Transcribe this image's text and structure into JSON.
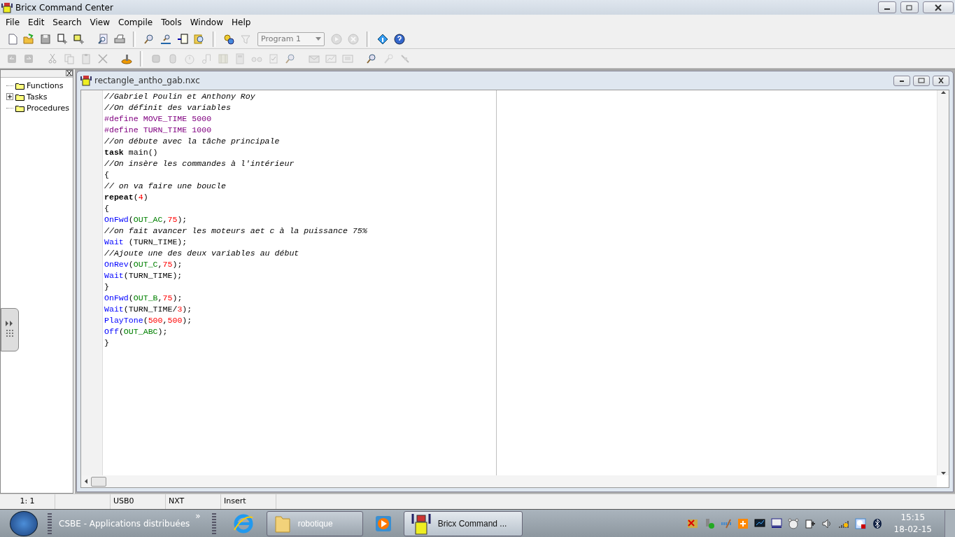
{
  "window": {
    "title": "Bricx Command Center"
  },
  "menu": [
    "File",
    "Edit",
    "Search",
    "View",
    "Compile",
    "Tools",
    "Window",
    "Help"
  ],
  "toolbar_1": [
    {
      "kind": "new",
      "disabled": false
    },
    {
      "kind": "open",
      "disabled": false
    },
    {
      "kind": "save",
      "disabled": false
    },
    {
      "kind": "download",
      "disabled": false
    },
    {
      "kind": "download-all",
      "disabled": false
    },
    {
      "kind": "sep"
    },
    {
      "kind": "preview",
      "disabled": false
    },
    {
      "kind": "print",
      "disabled": false
    },
    {
      "kind": "bar"
    },
    {
      "kind": "find",
      "disabled": false
    },
    {
      "kind": "replace",
      "disabled": false
    },
    {
      "kind": "goto",
      "disabled": false
    },
    {
      "kind": "find-file",
      "disabled": false
    },
    {
      "kind": "bar"
    },
    {
      "kind": "compile",
      "disabled": false
    },
    {
      "kind": "filter",
      "disabled": true
    },
    {
      "kind": "program",
      "value": "Program 1",
      "disabled": true
    },
    {
      "kind": "run",
      "disabled": true
    },
    {
      "kind": "stop",
      "disabled": true
    },
    {
      "kind": "bar"
    },
    {
      "kind": "info",
      "disabled": false
    },
    {
      "kind": "help",
      "disabled": false
    }
  ],
  "toolbar_2": [
    {
      "kind": "undo",
      "disabled": true
    },
    {
      "kind": "redo",
      "disabled": true
    },
    {
      "kind": "sep"
    },
    {
      "kind": "cut",
      "disabled": true
    },
    {
      "kind": "copy",
      "disabled": true
    },
    {
      "kind": "paste",
      "disabled": true
    },
    {
      "kind": "delete",
      "disabled": true
    },
    {
      "kind": "sep"
    },
    {
      "kind": "joystick",
      "disabled": false
    },
    {
      "kind": "bar"
    },
    {
      "kind": "robot",
      "disabled": true
    },
    {
      "kind": "bottle",
      "disabled": true
    },
    {
      "kind": "stopwatch",
      "disabled": true
    },
    {
      "kind": "note",
      "disabled": true
    },
    {
      "kind": "film",
      "disabled": true
    },
    {
      "kind": "calculator",
      "disabled": true
    },
    {
      "kind": "glasses",
      "disabled": true
    },
    {
      "kind": "checklist",
      "disabled": true
    },
    {
      "kind": "find",
      "disabled": true
    },
    {
      "kind": "sep"
    },
    {
      "kind": "mail",
      "disabled": true
    },
    {
      "kind": "chart",
      "disabled": true
    },
    {
      "kind": "screen",
      "disabled": true
    },
    {
      "kind": "sep"
    },
    {
      "kind": "find",
      "disabled": false
    },
    {
      "kind": "key",
      "disabled": true
    },
    {
      "kind": "plug",
      "disabled": true
    }
  ],
  "code_explorer": {
    "items": [
      {
        "label": "Functions"
      },
      {
        "label": "Tasks",
        "expanded": false
      },
      {
        "label": "Procedures"
      }
    ]
  },
  "editor": {
    "title": "rectangle_antho_gab.nxc",
    "lines": [
      [
        {
          "kind": "comment",
          "text": "//Gabriel Poulin et Anthony Roy"
        }
      ],
      [
        {
          "kind": "comment",
          "text": "//On définit des variables"
        }
      ],
      [
        {
          "kind": "preproc",
          "text": "#define "
        },
        {
          "kind": "macro",
          "text": "MOVE_TIME"
        },
        {
          "kind": "macro",
          "text": " 5000"
        }
      ],
      [
        {
          "kind": "preproc",
          "text": "#define "
        },
        {
          "kind": "macro",
          "text": "TURN_TIME"
        },
        {
          "kind": "macro",
          "text": " 1000"
        }
      ],
      [
        {
          "kind": "comment",
          "text": "//on débute avec la tâche principale"
        }
      ],
      [
        {
          "kind": "keyword",
          "text": "task"
        },
        {
          "kind": "plain",
          "text": " main()"
        }
      ],
      [
        {
          "kind": "comment",
          "text": "//On insère les commandes à l'intérieur"
        }
      ],
      [
        {
          "kind": "plain",
          "text": "{"
        }
      ],
      [
        {
          "kind": "comment",
          "text": "// on va faire une boucle"
        }
      ],
      [
        {
          "kind": "keyword",
          "text": "repeat"
        },
        {
          "kind": "plain",
          "text": "("
        },
        {
          "kind": "number",
          "text": "4"
        },
        {
          "kind": "plain",
          "text": ")"
        }
      ],
      [
        {
          "kind": "plain",
          "text": "{"
        }
      ],
      [
        {
          "kind": "func",
          "text": "OnFwd"
        },
        {
          "kind": "plain",
          "text": "("
        },
        {
          "kind": "const",
          "text": "OUT_AC"
        },
        {
          "kind": "plain",
          "text": ","
        },
        {
          "kind": "number",
          "text": "75"
        },
        {
          "kind": "plain",
          "text": ");"
        }
      ],
      [
        {
          "kind": "comment",
          "text": "//on fait avancer les moteurs aet c à la puissance 75%"
        }
      ],
      [
        {
          "kind": "func",
          "text": "Wait"
        },
        {
          "kind": "plain",
          "text": " (TURN_TIME);"
        }
      ],
      [
        {
          "kind": "comment",
          "text": "//Ajoute une des deux variables au début"
        }
      ],
      [
        {
          "kind": "func",
          "text": "OnRev"
        },
        {
          "kind": "plain",
          "text": "("
        },
        {
          "kind": "const",
          "text": "OUT_C"
        },
        {
          "kind": "plain",
          "text": ","
        },
        {
          "kind": "number",
          "text": "75"
        },
        {
          "kind": "plain",
          "text": ");"
        }
      ],
      [
        {
          "kind": "func",
          "text": "Wait"
        },
        {
          "kind": "plain",
          "text": "(TURN_TIME);"
        }
      ],
      [
        {
          "kind": "plain",
          "text": "}"
        }
      ],
      [
        {
          "kind": "func",
          "text": "OnFwd"
        },
        {
          "kind": "plain",
          "text": "("
        },
        {
          "kind": "const",
          "text": "OUT_B"
        },
        {
          "kind": "plain",
          "text": ","
        },
        {
          "kind": "number",
          "text": "75"
        },
        {
          "kind": "plain",
          "text": ");"
        }
      ],
      [
        {
          "kind": "func",
          "text": "Wait"
        },
        {
          "kind": "plain",
          "text": "(TURN_TIME/"
        },
        {
          "kind": "number",
          "text": "3"
        },
        {
          "kind": "plain",
          "text": ");"
        }
      ],
      [
        {
          "kind": "func",
          "text": "PlayTone"
        },
        {
          "kind": "plain",
          "text": "("
        },
        {
          "kind": "number",
          "text": "500"
        },
        {
          "kind": "plain",
          "text": ","
        },
        {
          "kind": "number",
          "text": "500"
        },
        {
          "kind": "plain",
          "text": ");"
        }
      ],
      [
        {
          "kind": "func",
          "text": "Off"
        },
        {
          "kind": "plain",
          "text": "("
        },
        {
          "kind": "const",
          "text": "OUT_ABC"
        },
        {
          "kind": "plain",
          "text": ");"
        }
      ],
      [
        {
          "kind": "plain",
          "text": "}"
        }
      ]
    ]
  },
  "status_bar": [
    "1: 1",
    "USB0",
    "NXT",
    "Insert"
  ],
  "taskbar": {
    "toolbar_label": "CSBE - Applications distribuées",
    "toolbar_more": "»",
    "buttons": [
      {
        "kind": "folder",
        "label": "robotique",
        "selected": false
      },
      {
        "kind": "media",
        "selected": false
      },
      {
        "kind": "bricx",
        "label": "Bricx Command ...",
        "selected": true
      }
    ],
    "tray": [
      {
        "kind": "tool"
      },
      {
        "kind": "usb"
      },
      {
        "kind": "network"
      },
      {
        "kind": "shield"
      },
      {
        "kind": "monitor"
      },
      {
        "kind": "display"
      },
      {
        "kind": "bear"
      },
      {
        "kind": "power"
      },
      {
        "kind": "volume"
      },
      {
        "kind": "signal"
      },
      {
        "kind": "disc"
      },
      {
        "kind": "bluetooth"
      }
    ],
    "time": "15:15",
    "date": "18-02-15"
  }
}
